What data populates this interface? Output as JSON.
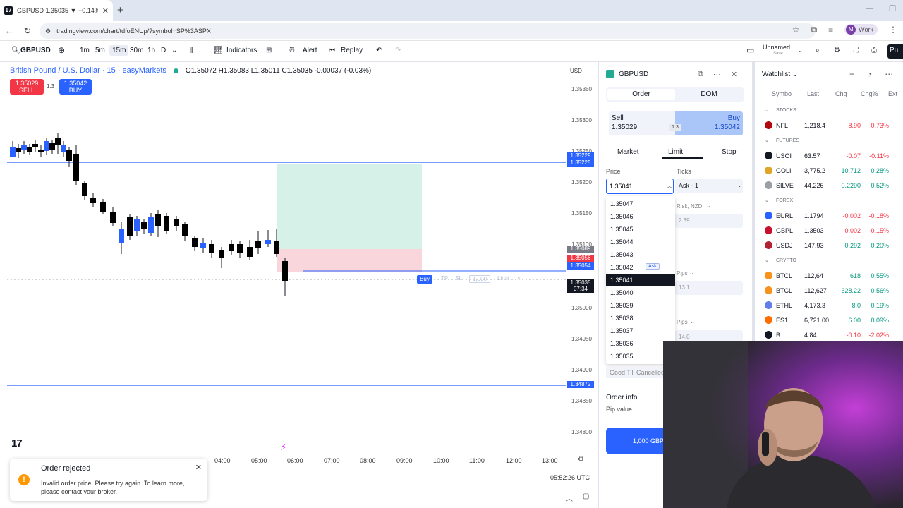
{
  "browser": {
    "tab_title": "GBPUSD 1.35035 ▼ −0.14% Un",
    "url": "tradingview.com/chart/tdfoENUp/?symbol=SP%3ASPX",
    "profile_label": "Work",
    "profile_initial": "M"
  },
  "toolbar": {
    "symbol": "GBPUSD",
    "intervals": [
      "1m",
      "5m",
      "15m",
      "30m",
      "1h",
      "D"
    ],
    "selected_interval": "15m",
    "indicators_label": "Indicators",
    "alert_label": "Alert",
    "replay_label": "Replay",
    "layout_name": "Unnamed",
    "layout_status": "Save",
    "publish_label": "Pu"
  },
  "chart": {
    "title": "British Pound / U.S. Dollar · 15 · easyMarkets",
    "ohlc": "O1.35072 H1.35083 L1.35011 C1.35035 -0.00037 (-0.03%)",
    "sell_price": "1.35029",
    "sell_label": "SELL",
    "buy_price": "1.35042",
    "buy_label": "BUY",
    "spread": "1.3",
    "currency": "USD",
    "price_ticks": [
      "1.35350",
      "1.35300",
      "1.35250",
      "1.35200",
      "1.35150",
      "1.35100",
      "1.35000",
      "1.34950",
      "1.34900",
      "1.34850",
      "1.34800"
    ],
    "price_labels": [
      {
        "text": "1.35229",
        "color": "#2962ff"
      },
      {
        "text": "1.35225",
        "color": "#2962ff"
      },
      {
        "text": "1.35089",
        "color": "#787b86"
      },
      {
        "text": "1.35056",
        "color": "#f23645"
      },
      {
        "text": "1.35054",
        "color": "#2962ff"
      },
      {
        "text": "1.35035",
        "color": "#131722"
      },
      {
        "text": "07:34",
        "color": "#131722"
      },
      {
        "text": "1.34872",
        "color": "#2962ff"
      }
    ],
    "time_ticks": [
      "04:00",
      "05:00",
      "06:00",
      "07:00",
      "08:00",
      "09:00",
      "10:00",
      "11:00",
      "12:00",
      "13:00"
    ],
    "clock": "05:52:26 UTC",
    "order_line": {
      "side_label": "Buy",
      "tp": "TP",
      "sl": "SL",
      "qty": "1,000",
      "type": "Limit"
    }
  },
  "toast": {
    "title": "Order rejected",
    "message": "Invalid order price. Please try again. To learn more, please contact your broker."
  },
  "order_panel": {
    "symbol": "GBPUSD",
    "tabs": [
      "Order",
      "DOM"
    ],
    "sell_label": "Sell",
    "sell_price": "1.35029",
    "buy_label": "Buy",
    "buy_price": "1.35042",
    "spread": "1.3",
    "order_types": [
      "Market",
      "Limit",
      "Stop"
    ],
    "active_type": "Limit",
    "price_label": "Price",
    "price_value": "1.35041",
    "ticks_label": "Ticks",
    "ticks_value": "Ask - 1",
    "risk_label": "Risk, NZD",
    "risk_value": "2.39",
    "pips_label": "Pips",
    "pips_value_1": "13.1",
    "pips_value_2": "14.0",
    "price_options": [
      "1.35047",
      "1.35046",
      "1.35045",
      "1.35044",
      "1.35043",
      "1.35042",
      "1.35041",
      "1.35040",
      "1.35039",
      "1.35038",
      "1.35037",
      "1.35036",
      "1.35035"
    ],
    "selected_option": "1.35041",
    "ask_badge": "Ask",
    "ask_option": "1.35042",
    "tif": "Good Till Cancelled",
    "order_info_label": "Order info",
    "pip_value_label": "Pip value",
    "place_button": "1,000 GBPUSD"
  },
  "watchlist": {
    "title": "Watchlist",
    "columns": [
      "Symbo",
      "Last",
      "Chg",
      "Chg%",
      "Ext"
    ],
    "sections": [
      {
        "name": "STOCKS",
        "rows": [
          {
            "symbol": "NFL",
            "last": "1,218.4",
            "chg": "-8.90",
            "chgp": "-0.73%",
            "dir": "neg",
            "icon_color": "#b1060f"
          }
        ]
      },
      {
        "name": "FUTURES",
        "rows": [
          {
            "symbol": "USOI",
            "last": "63.57",
            "chg": "-0.07",
            "chgp": "-0.11%",
            "dir": "neg",
            "icon_color": "#131722"
          },
          {
            "symbol": "GOLI",
            "last": "3,775.2",
            "chg": "10.712",
            "chgp": "0.28%",
            "dir": "pos",
            "icon_color": "#e0a526"
          },
          {
            "symbol": "SILVE",
            "last": "44.226",
            "chg": "0.2290",
            "chgp": "0.52%",
            "dir": "pos",
            "icon_color": "#9aa0a6"
          }
        ]
      },
      {
        "name": "FOREX",
        "rows": [
          {
            "symbol": "EURL",
            "last": "1.1794",
            "chg": "-0.002",
            "chgp": "-0.18%",
            "dir": "neg",
            "icon_color": "#2962ff"
          },
          {
            "symbol": "GBPL",
            "last": "1.3503",
            "chg": "-0.002",
            "chgp": "-0.15%",
            "dir": "neg",
            "icon_color": "#c8102e"
          },
          {
            "symbol": "USDJ",
            "last": "147.93",
            "chg": "0.292",
            "chgp": "0.20%",
            "dir": "pos",
            "icon_color": "#b22234"
          }
        ]
      },
      {
        "name": "CRYPTO",
        "rows": [
          {
            "symbol": "BTCL",
            "last": "112,64",
            "chg": "618",
            "chgp": "0.55%",
            "dir": "pos",
            "icon_color": "#f7931a"
          },
          {
            "symbol": "BTCL",
            "last": "112,627",
            "chg": "628.22",
            "chgp": "0.56%",
            "dir": "pos",
            "icon_color": "#f7931a"
          },
          {
            "symbol": "ETHL",
            "last": "4,173.3",
            "chg": "8.0",
            "chgp": "0.19%",
            "dir": "pos",
            "icon_color": "#627eea"
          },
          {
            "symbol": "ES1",
            "last": "6,721.00",
            "chg": "6.00",
            "chgp": "0.09%",
            "dir": "pos",
            "icon_color": "#ff6d00"
          },
          {
            "symbol": "B",
            "last": "4.84",
            "chg": "-0.10",
            "chgp": "-2.02%",
            "dir": "neg",
            "icon_color": "#131722"
          }
        ]
      }
    ]
  }
}
